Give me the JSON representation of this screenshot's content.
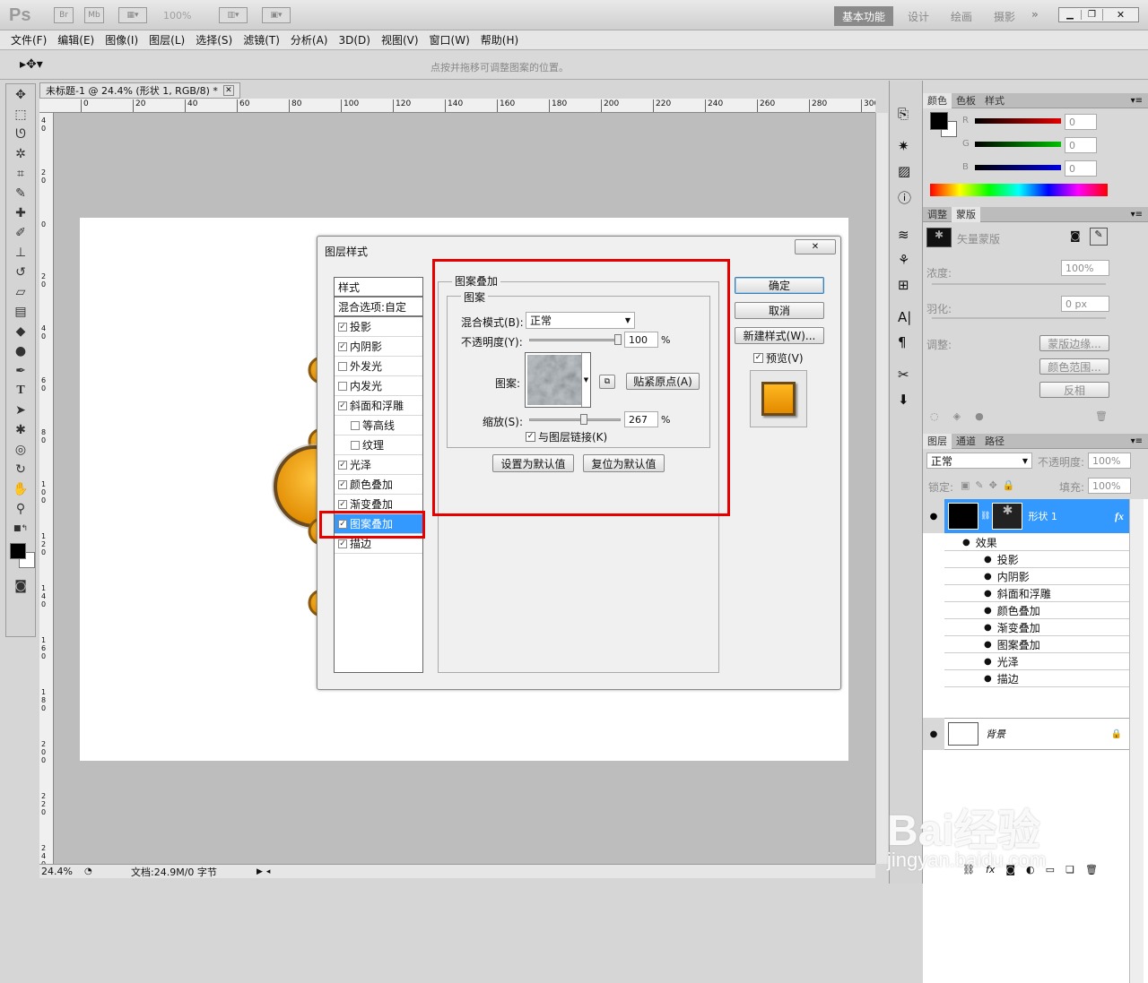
{
  "appbar": {
    "logo": "Ps",
    "br": "Br",
    "mb": "Mb",
    "zoom": "100%",
    "workspaces": [
      "基本功能",
      "设计",
      "绘画",
      "摄影"
    ],
    "active_workspace": "基本功能",
    "more": "»"
  },
  "menu": [
    "文件(F)",
    "编辑(E)",
    "图像(I)",
    "图层(L)",
    "选择(S)",
    "滤镜(T)",
    "分析(A)",
    "3D(D)",
    "视图(V)",
    "窗口(W)",
    "帮助(H)"
  ],
  "options": {
    "hint": "点按并拖移可调整图案的位置。"
  },
  "document": {
    "tab_title": "未标题-1 @ 24.4% (形状 1, RGB/8) *",
    "ruler_top": [
      "0",
      "20",
      "40",
      "60",
      "80",
      "100",
      "120",
      "140",
      "160",
      "180",
      "200",
      "220",
      "240",
      "260",
      "280",
      "300"
    ],
    "ruler_left": [
      "4 0",
      "2 0",
      "0",
      "2 0",
      "4 0",
      "6 0",
      "8 0",
      "1 0 0",
      "1 2 0",
      "1 4 0",
      "1 6 0",
      "1 8 0",
      "2 0 0",
      "2 2 0",
      "2 4 0"
    ],
    "zoom": "24.4%",
    "doc_info": "文档:24.9M/0 字节"
  },
  "dialog": {
    "title": "图层样式",
    "styles_header": "样式",
    "blend_options": "混合选项:自定",
    "items": [
      {
        "label": "投影",
        "checked": true
      },
      {
        "label": "内阴影",
        "checked": true
      },
      {
        "label": "外发光",
        "checked": false
      },
      {
        "label": "内发光",
        "checked": false
      },
      {
        "label": "斜面和浮雕",
        "checked": true
      },
      {
        "label": "等高线",
        "checked": false
      },
      {
        "label": "纹理",
        "checked": false
      },
      {
        "label": "光泽",
        "checked": true
      },
      {
        "label": "颜色叠加",
        "checked": true
      },
      {
        "label": "渐变叠加",
        "checked": true
      },
      {
        "label": "图案叠加",
        "checked": true
      },
      {
        "label": "描边",
        "checked": true
      }
    ],
    "section_title": "图案叠加",
    "group_title": "图案",
    "blend_mode_label": "混合模式(B):",
    "blend_mode_value": "正常",
    "opacity_label": "不透明度(Y):",
    "opacity_value": "100",
    "opacity_unit": "%",
    "opacity_level": 1.0,
    "pattern_label": "图案:",
    "snap_button": "贴紧原点(A)",
    "scale_label": "缩放(S):",
    "scale_value": "267",
    "scale_unit": "%",
    "scale_level": 0.6,
    "link_label": "与图层链接(K)",
    "set_default": "设置为默认值",
    "reset_default": "复位为默认值",
    "ok": "确定",
    "cancel": "取消",
    "new_style": "新建样式(W)...",
    "preview": "预览(V)",
    "close": "✕"
  },
  "color_panel": {
    "tabs": [
      "颜色",
      "色板",
      "样式"
    ],
    "channels": [
      {
        "label": "R",
        "value": "0"
      },
      {
        "label": "G",
        "value": "0"
      },
      {
        "label": "B",
        "value": "0"
      }
    ]
  },
  "mask_panel": {
    "tabs": [
      "调整",
      "蒙版"
    ],
    "vector_mask": "矢量蒙版",
    "density_label": "浓度:",
    "density_value": "100%",
    "feather_label": "羽化:",
    "feather_value": "0 px",
    "refine_label": "调整:",
    "buttons": [
      "蒙版边缘...",
      "颜色范围...",
      "反相"
    ]
  },
  "layers_panel": {
    "tabs": [
      "图层",
      "通道",
      "路径"
    ],
    "blend": "正常",
    "opacity_label": "不透明度:",
    "opacity": "100%",
    "lock_label": "锁定:",
    "fill_label": "填充:",
    "fill": "100%",
    "layers": [
      {
        "name": "形状 1",
        "effects_label": "效果",
        "effects": [
          "投影",
          "内阴影",
          "斜面和浮雕",
          "颜色叠加",
          "渐变叠加",
          "图案叠加",
          "光泽",
          "描边"
        ]
      },
      {
        "name": "背景"
      }
    ]
  },
  "watermark": {
    "brand": "Bai经验",
    "url": "jingyan.baidu.com"
  },
  "colors": {
    "accent": "#3399ff",
    "highlight": "#e60000",
    "orange": "#f0a000"
  }
}
